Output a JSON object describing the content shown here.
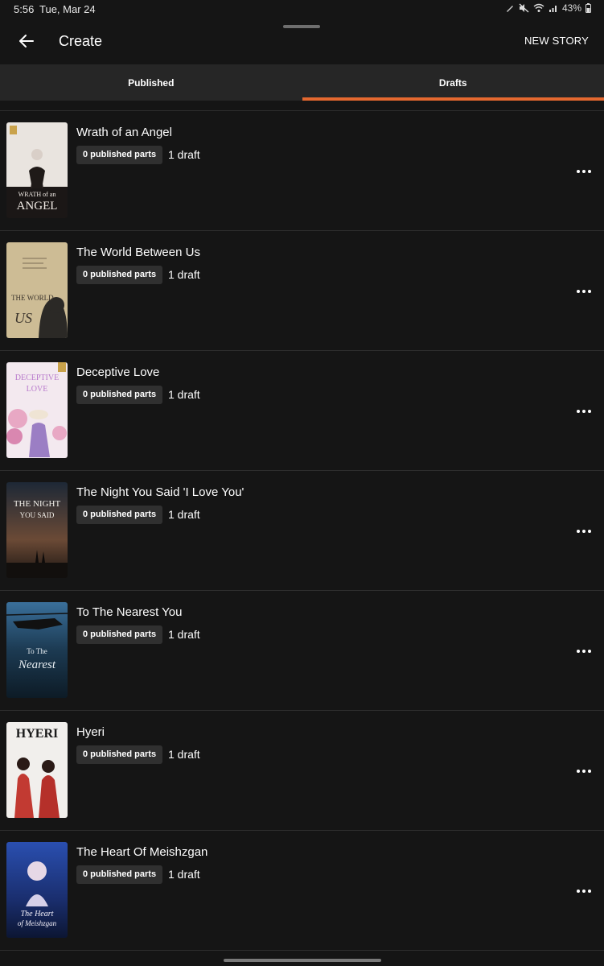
{
  "status_bar": {
    "time": "5:56",
    "date": "Tue, Mar 24",
    "battery": "43%"
  },
  "header": {
    "title": "Create",
    "new_story_label": "NEW STORY"
  },
  "tabs": [
    {
      "label": "Published",
      "active": false
    },
    {
      "label": "Drafts",
      "active": true
    }
  ],
  "accent_color": "#e4682f",
  "stories": [
    {
      "title": "Wrath of an Angel",
      "parts": "0 published parts",
      "drafts": "1 draft",
      "cover": {
        "text_top": "WRATH of an",
        "text_bottom": "ANGEL"
      }
    },
    {
      "title": "The World Between Us",
      "parts": "0 published parts",
      "drafts": "1 draft",
      "cover": {
        "text_top": "THE WORLD",
        "text_bottom": "US"
      }
    },
    {
      "title": "Deceptive Love",
      "parts": "0 published parts",
      "drafts": "1 draft",
      "cover": {
        "text_top": "DECEPTIVE",
        "text_bottom": "LOVE"
      }
    },
    {
      "title": "The Night You Said 'I Love You'",
      "parts": "0 published parts",
      "drafts": "1 draft",
      "cover": {
        "text_top": "THE NIGHT",
        "text_bottom": "YOU SAID"
      }
    },
    {
      "title": "To The Nearest You",
      "parts": "0 published parts",
      "drafts": "1 draft",
      "cover": {
        "text_top": "To The",
        "text_bottom": "Nearest"
      }
    },
    {
      "title": "Hyeri",
      "parts": "0 published parts",
      "drafts": "1 draft",
      "cover": {
        "text_top": "HYERI",
        "text_bottom": ""
      }
    },
    {
      "title": "The Heart Of Meishzgan",
      "parts": "0 published parts",
      "drafts": "1 draft",
      "cover": {
        "text_top": "The Heart",
        "text_bottom": "of Meishzgan"
      }
    }
  ]
}
